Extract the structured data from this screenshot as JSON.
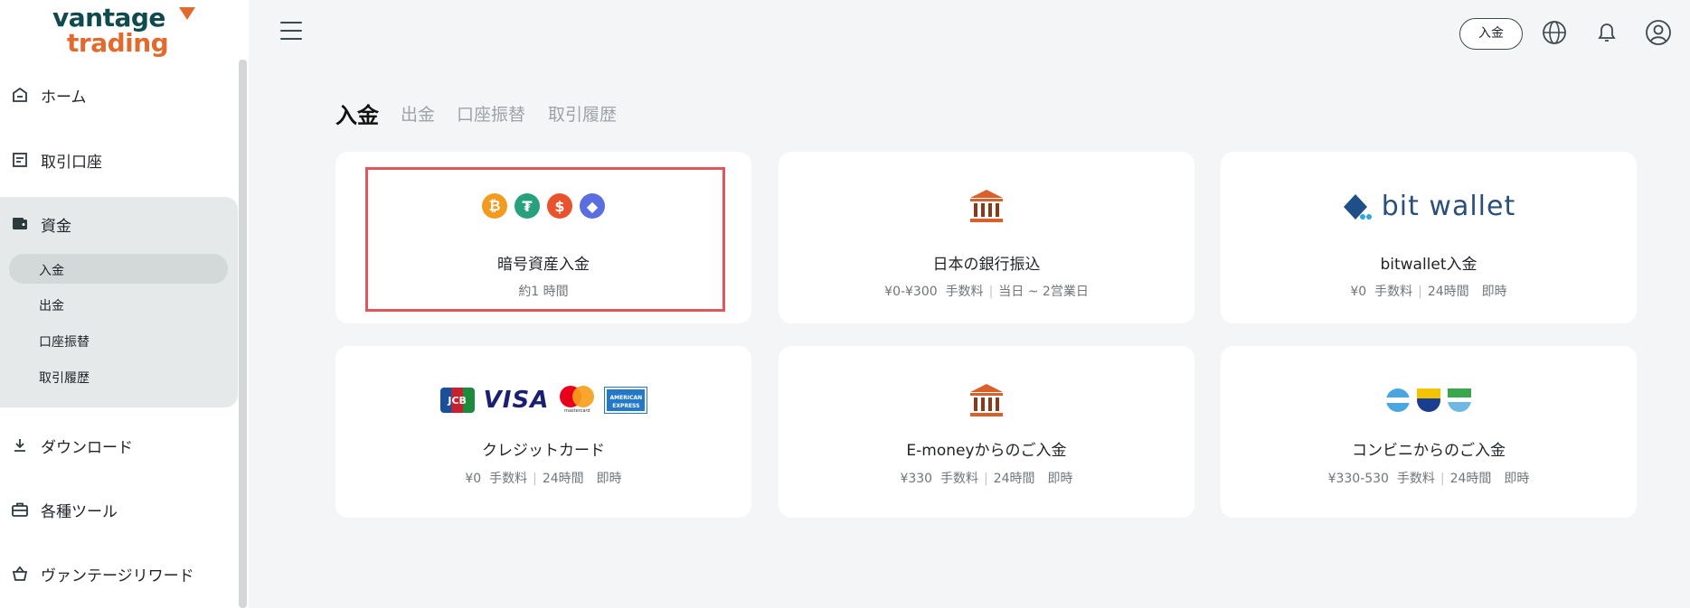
{
  "brand": {
    "line1": "vantage",
    "line2": "trading"
  },
  "nav": {
    "home": "ホーム",
    "accounts": "取引口座",
    "funds": "資金",
    "funds_sub": [
      "入金",
      "出金",
      "口座振替",
      "取引履歴"
    ],
    "download": "ダウンロード",
    "tools": "各種ツール",
    "rewards": "ヴァンテージリワード"
  },
  "header": {
    "deposit_button": "入金"
  },
  "tabs": [
    "入金",
    "出金",
    "口座振替",
    "取引履歴"
  ],
  "methods": [
    {
      "title": "暗号資産入金",
      "meta": "約1 時間",
      "icon": "crypto-coins-icons"
    },
    {
      "title": "日本の銀行振込",
      "fee": "¥0-¥300",
      "fee_label": "手数料",
      "time": "当日 ~ 2営業日",
      "icon": "bank-icon"
    },
    {
      "title": "bitwallet入金",
      "fee": "¥0",
      "fee_label": "手数料",
      "time": "24時間　即時",
      "icon": "bitwallet-logo",
      "logo_text": "bit wallet"
    },
    {
      "title": "クレジットカード",
      "fee": "¥0",
      "fee_label": "手数料",
      "time": "24時間　即時",
      "icon": "card-brands-icons"
    },
    {
      "title": "E-moneyからのご入金",
      "fee": "¥330",
      "fee_label": "手数料",
      "time": "24時間　即時",
      "icon": "bank-icon"
    },
    {
      "title": "コンビニからのご入金",
      "fee": "¥330-530",
      "fee_label": "手数料",
      "time": "24時間　即時",
      "icon": "convenience-store-icons"
    }
  ],
  "card_brand_labels": {
    "jcb": "JCB",
    "visa": "VISA",
    "mastercard": "mastercard",
    "amex": "AMERICAN EXPRESS"
  },
  "colors": {
    "accent": "#e36a2e",
    "dark": "#0f4a4f",
    "highlight": "#e0565b"
  }
}
